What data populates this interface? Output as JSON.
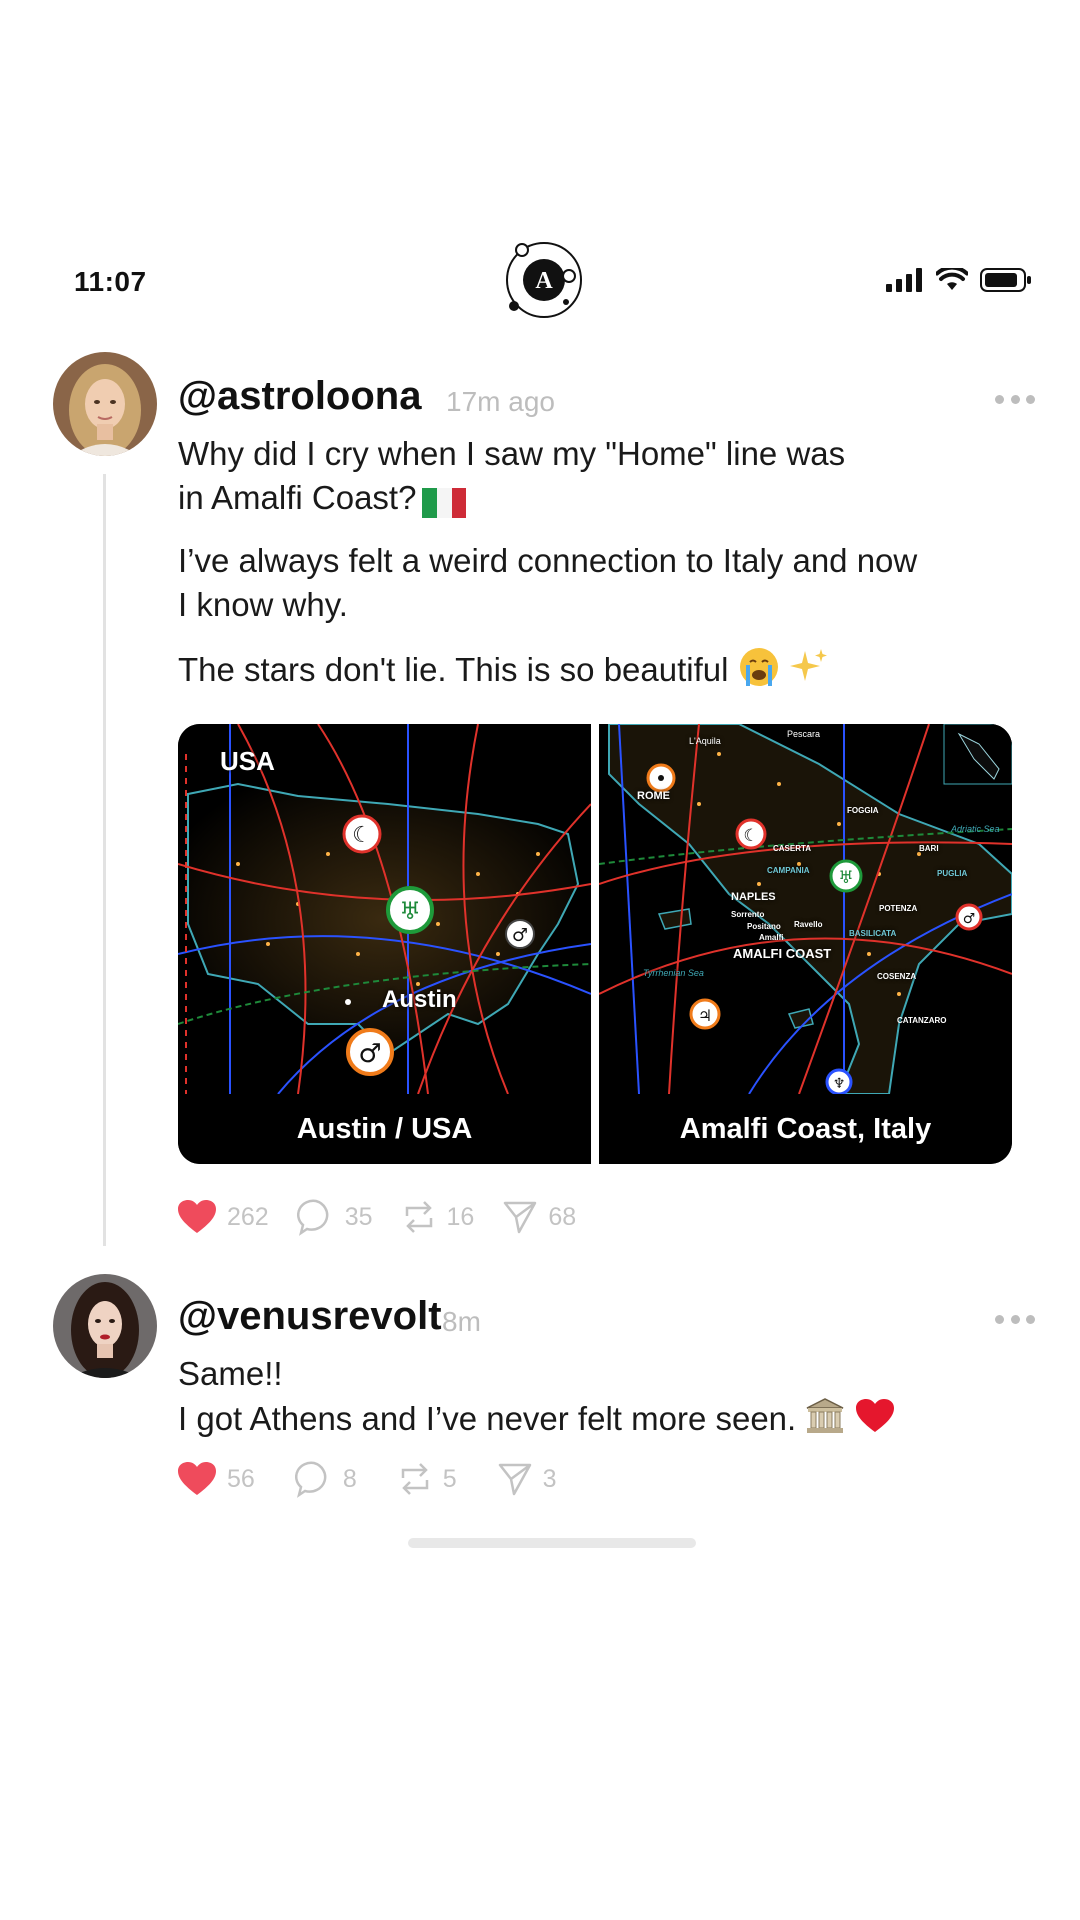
{
  "status_bar": {
    "time": "11:07"
  },
  "app": {
    "logo_letter": "A"
  },
  "posts": [
    {
      "username": "@astroloona",
      "time_ago": "17m ago",
      "line1": "Why did I cry when I saw my \"Home\" line was",
      "line2": "in Amalfi Coast?",
      "para2_line1": "I’ve always felt a weird connection to Italy and now",
      "para2_line2": "I know why.",
      "para3": "The stars don't lie. This is so beautiful",
      "images": [
        {
          "caption": "Austin / USA",
          "label_country": "USA",
          "label_city": "Austin"
        },
        {
          "caption": "Amalfi Coast, Italy",
          "labels": [
            "ROME",
            "NAPLES",
            "AMALFI COAST",
            "Pescara",
            "L'Aquila",
            "FOGGIA",
            "BARI",
            "POTENZA",
            "PUGLIA",
            "BASILICATA",
            "COSENZA",
            "CATANZARO",
            "Sorrento",
            "Positano",
            "Amalfi",
            "Ravello",
            "CAMPANIA",
            "CASERTA",
            "Tyrrhenian Sea",
            "Adriatic Sea"
          ]
        }
      ],
      "stats": {
        "likes": "262",
        "comments": "35",
        "reposts": "16",
        "shares": "68"
      }
    },
    {
      "username": "@venusrevolt",
      "time_ago": "8m",
      "line1": "Same!!",
      "line2": "I got Athens and I’ve never felt more seen.",
      "stats": {
        "likes": "56",
        "comments": "8",
        "reposts": "5",
        "shares": "3"
      }
    }
  ],
  "colors": {
    "like": "#ef4b5c",
    "muted": "#c3c3c3",
    "italy_green": "#1f9a4a",
    "italy_red": "#ce2b37"
  }
}
